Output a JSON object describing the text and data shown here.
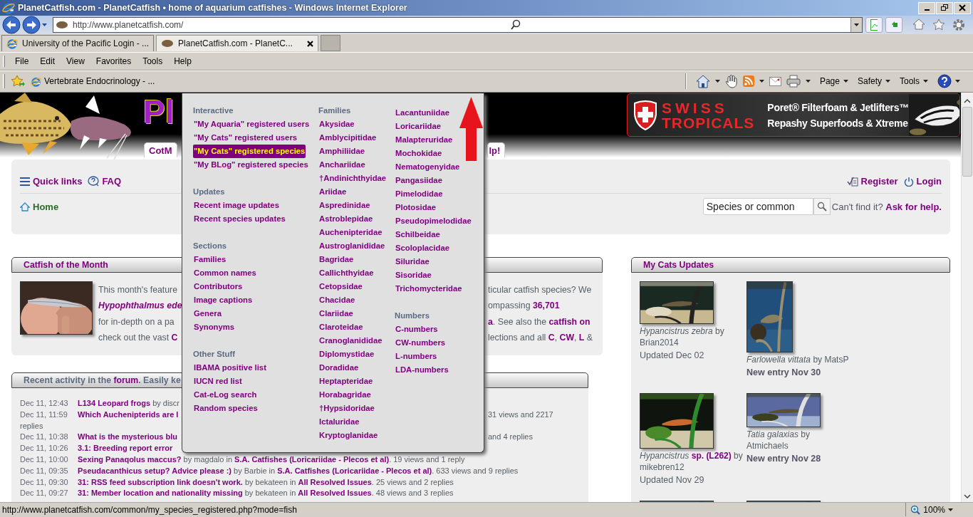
{
  "window": {
    "title": "PlanetCatfish.com - PlanetCatfish • home of aquarium catfishes - Windows Internet Explorer"
  },
  "address_bar": {
    "url": "http://www.planetcatfish.com/"
  },
  "browser_tabs": [
    {
      "label": "University of the Pacific Login - ...",
      "selected": false
    },
    {
      "label": "PlanetCatfish.com - PlanetC...",
      "selected": true
    }
  ],
  "menu_bar": [
    "File",
    "Edit",
    "View",
    "Favorites",
    "Tools",
    "Help"
  ],
  "favorites_bar": [
    "Vertebrate Endocrinology - ..."
  ],
  "command_bar": [
    "Page",
    "Safety",
    "Tools"
  ],
  "site": {
    "logo_text": "Pl",
    "tabs": [
      {
        "label": "CotM"
      },
      {
        "label": "lp!"
      }
    ],
    "ad": {
      "brand": [
        "SWISS",
        "TROPICALS"
      ],
      "lines": [
        "Poret® Filterfoam & Jetlifters™",
        "Repashy Superfoods & Xtreme"
      ]
    },
    "nav": {
      "quick_links": "Quick links",
      "faq": "FAQ",
      "register": "Register",
      "login": "Login",
      "breadcrumb": "Home",
      "search": {
        "placeholder": "Species or common"
      },
      "help_prompt": "Can't find it?",
      "help_link": "Ask for help."
    },
    "cotm": {
      "title": "Catfish of the Month",
      "lines": [
        {
          "left": "This month's feature",
          "kind": "plain",
          "right": "ticular catfish species? We"
        },
        {
          "left": "Hypophthalmus ede",
          "kind": "species",
          "right": "ompassing **36,701**"
        },
        {
          "left": "for in-depth on a pa",
          "kind": "plain",
          "right": "**a**. See also the **catfish on**"
        },
        {
          "left": "check out the vast **C**",
          "kind": "plain",
          "right": "lections and all **C**, **CW**, **L** &"
        }
      ]
    },
    "activity": {
      "title": "Recent activity in the **forum**. Easily ke",
      "rows": [
        {
          "date": "Dec 11, 12:43",
          "text": "**L134 Leopard frogs** by discr"
        },
        {
          "date": "Dec 11, 11:59",
          "text": "**Which Auchenipterids are l**",
          "right": "31 views and 2217",
          "continued": "replies"
        },
        {
          "date": "Dec 11, 10:38",
          "text": "**What is the mysterious blu**",
          "right": "and 4 replies"
        },
        {
          "date": "Dec 11, 10:26",
          "text": "**3.1: Breeding report error**"
        },
        {
          "date": "Dec 11, 10:00",
          "text": "**Sexing Panaqolus maccus?** by magdalo in **S.A. Catfishes (Loricariidae - Plecos et al)**. 19 views and 1 reply"
        },
        {
          "date": "Dec 11, 09:35",
          "text": "**Pseudacanthicus setup? Advice please :)** by Barbie in **S.A. Catfishes (Loricariidae - Plecos et al)**. 633 views and 9 replies"
        },
        {
          "date": "Dec 11, 09:30",
          "text": "**31: RSS feed subscription link doesn't work.** by bekateen in **All Resolved Issues**. 25 views and 2 replies"
        },
        {
          "date": "Dec 11, 09:27",
          "text": "**31: Member location and nationality missing** by bekateen in **All Resolved Issues**. 48 views and 3 replies"
        }
      ]
    },
    "my_cats": {
      "title": "My Cats Updates",
      "entries": [
        {
          "kind": "entry",
          "caption": "*Hypancistrus zebra* by Brian2014",
          "status": "Updated Dec 02",
          "new": false
        },
        {
          "kind": "entry",
          "caption": "*Farlowella vittata* by MatsP",
          "status": "New entry Nov 30",
          "new": true
        },
        {
          "kind": "entry",
          "caption": "*Hypancistrus* **sp. (L262)** by mikebren12",
          "status": "Updated Nov 29",
          "new": false
        },
        {
          "kind": "entry",
          "caption": "*Tatia galaxias* by Atmichaels",
          "status": "New entry Nov 28",
          "new": true
        },
        {
          "kind": "picture"
        },
        {
          "kind": "picture"
        }
      ]
    }
  },
  "mega_menu": {
    "columns": [
      {
        "groups": [
          {
            "heading": "Interactive",
            "items": [
              {
                "label": "\"My Aquaria\" registered users",
                "selected": false
              },
              {
                "label": "\"My Cats\" registered users",
                "selected": false
              },
              {
                "label": "\"My Cats\" registered species",
                "selected": true
              },
              {
                "label": "\"My BLog\" registered species",
                "selected": false
              }
            ]
          },
          {
            "heading": "Updates",
            "items": [
              {
                "label": "Recent image updates",
                "selected": false
              },
              {
                "label": "Recent species updates",
                "selected": false
              }
            ]
          },
          {
            "heading": "Sections",
            "items": [
              {
                "label": "Families",
                "selected": false
              },
              {
                "label": "Common names",
                "selected": false
              },
              {
                "label": "Contributors",
                "selected": false
              },
              {
                "label": "Image captions",
                "selected": false
              },
              {
                "label": "Genera",
                "selected": false
              },
              {
                "label": "Synonyms",
                "selected": false
              }
            ]
          },
          {
            "heading": "Other Stuff",
            "items": [
              {
                "label": "IBAMA positive list",
                "selected": false
              },
              {
                "label": "IUCN red list",
                "selected": false
              },
              {
                "label": "Cat-eLog search",
                "selected": false
              },
              {
                "label": "Random species",
                "selected": false
              }
            ]
          }
        ]
      },
      {
        "groups": [
          {
            "heading": "Families",
            "items": [
              {
                "label": "Akysidae",
                "selected": false
              },
              {
                "label": "Amblycipitidae",
                "selected": false
              },
              {
                "label": "Amphiliidae",
                "selected": false
              },
              {
                "label": "Anchariidae",
                "selected": false
              },
              {
                "label": "†Andinichthyidae",
                "selected": false
              },
              {
                "label": "Ariidae",
                "selected": false
              },
              {
                "label": "Aspredinidae",
                "selected": false
              },
              {
                "label": "Astroblepidae",
                "selected": false
              },
              {
                "label": "Auchenipteridae",
                "selected": false
              },
              {
                "label": "Austroglanididae",
                "selected": false
              },
              {
                "label": "Bagridae",
                "selected": false
              },
              {
                "label": "Callichthyidae",
                "selected": false
              },
              {
                "label": "Cetopsidae",
                "selected": false
              },
              {
                "label": "Chacidae",
                "selected": false
              },
              {
                "label": "Clariidae",
                "selected": false
              },
              {
                "label": "Claroteidae",
                "selected": false
              },
              {
                "label": "Cranoglanididae",
                "selected": false
              },
              {
                "label": "Diplomystidae",
                "selected": false
              },
              {
                "label": "Doradidae",
                "selected": false
              },
              {
                "label": "Heptapteridae",
                "selected": false
              },
              {
                "label": "Horabagridae",
                "selected": false
              },
              {
                "label": "†Hypsidoridae",
                "selected": false
              },
              {
                "label": "Ictaluridae",
                "selected": false
              },
              {
                "label": "Kryptoglanidae",
                "selected": false
              }
            ]
          }
        ]
      },
      {
        "groups": [
          {
            "items": [
              {
                "label": "Lacantuniidae",
                "selected": false
              },
              {
                "label": "Loricariidae",
                "selected": false
              },
              {
                "label": "Malapteruridae",
                "selected": false
              },
              {
                "label": "Mochokidae",
                "selected": false
              },
              {
                "label": "Nematogenyidae",
                "selected": false
              },
              {
                "label": "Pangasiidae",
                "selected": false
              },
              {
                "label": "Pimelodidae",
                "selected": false
              },
              {
                "label": "Plotosidae",
                "selected": false
              },
              {
                "label": "Pseudopimelodidae",
                "selected": false
              },
              {
                "label": "Schilbeidae",
                "selected": false
              },
              {
                "label": "Scoloplacidae",
                "selected": false
              },
              {
                "label": "Siluridae",
                "selected": false
              },
              {
                "label": "Sisoridae",
                "selected": false
              },
              {
                "label": "Trichomycteridae",
                "selected": false
              }
            ]
          },
          {
            "heading": "Numbers",
            "items": [
              {
                "label": "C-numbers",
                "selected": false
              },
              {
                "label": "CW-numbers",
                "selected": false
              },
              {
                "label": "L-numbers",
                "selected": false
              },
              {
                "label": "LDA-numbers",
                "selected": false
              }
            ]
          }
        ]
      }
    ]
  },
  "status_bar": {
    "url": "http://www.planetcatfish.com/common/my_species_registered.php?mode=fish",
    "zoom": "100%"
  }
}
